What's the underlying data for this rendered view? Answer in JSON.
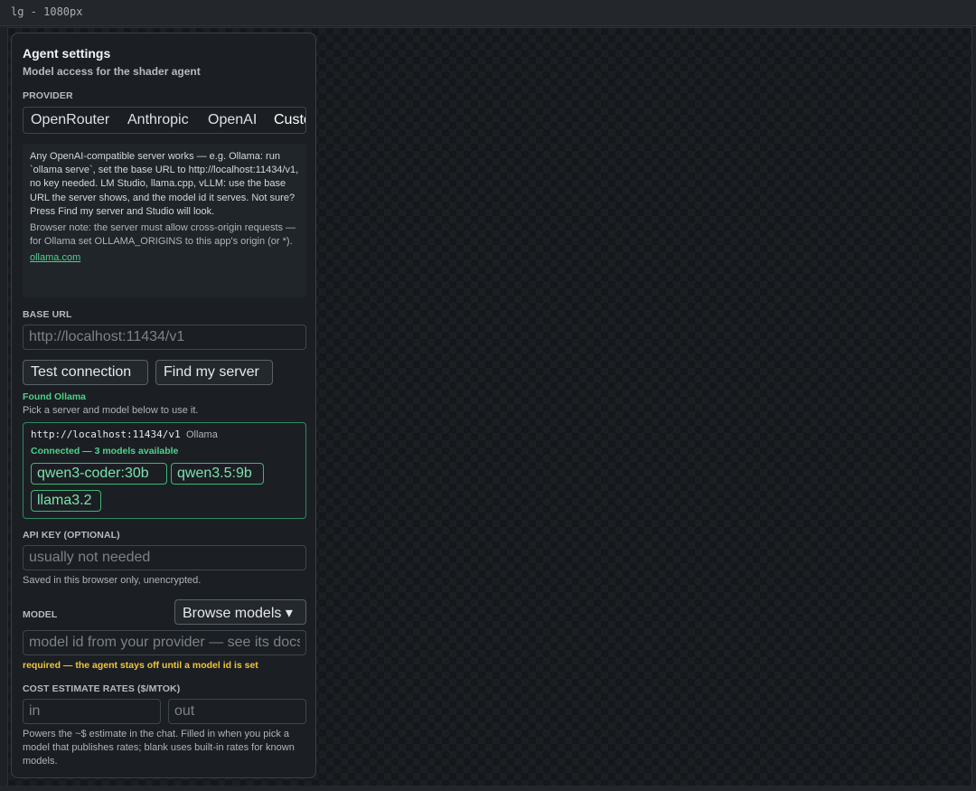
{
  "window": {
    "label": "lg - 1080px"
  },
  "panel": {
    "title": "Agent settings",
    "subtitle": "Model access for the shader agent",
    "provider": {
      "label": "PROVIDER",
      "tabs": [
        "OpenRouter",
        "Anthropic",
        "OpenAI",
        "Custom"
      ],
      "selected": "Custom"
    },
    "info": {
      "text": "Any OpenAI-compatible server works — e.g. Ollama: run `ollama serve`, set the base URL to http://localhost:11434/v1, no key needed. LM Studio, llama.cpp, vLLM: use the base URL the server shows, and the model id it serves. Not sure? Press Find my server and Studio will look.",
      "note": "Browser note: the server must allow cross-origin requests — for Ollama set OLLAMA_ORIGINS to this app's origin (or *).",
      "link": "ollama.com"
    },
    "base_url": {
      "label": "BASE URL",
      "placeholder": "http://localhost:11434/v1",
      "value": ""
    },
    "buttons": {
      "test": "Test connection",
      "find": "Find my server"
    },
    "found": {
      "status": "Found Ollama",
      "hint": "Pick a server and model below to use it."
    },
    "server": {
      "url": "http://localhost:11434/v1",
      "kind": "Ollama",
      "status": "Connected — 3 models available",
      "models": [
        "qwen3-coder:30b",
        "qwen3.5:9b",
        "llama3.2"
      ]
    },
    "api_key": {
      "label": "API KEY (OPTIONAL)",
      "placeholder": "usually not needed",
      "value": "",
      "hint": "Saved in this browser only, unencrypted."
    },
    "model": {
      "label": "MODEL",
      "browse": "Browse models ▾",
      "placeholder": "model id from your provider — see its docs",
      "value": "",
      "warning": "required — the agent stays off until a model id is set"
    },
    "rates": {
      "label": "COST ESTIMATE RATES ($/MTOK)",
      "in_placeholder": "in",
      "out_placeholder": "out",
      "hint": "Powers the ~$ estimate in the chat. Filled in when you pick a model that publishes rates; blank uses built-in rates for known models."
    }
  },
  "colors": {
    "accent_green": "#4fd08a",
    "warning_yellow": "#f0c43a",
    "panel_bg": "#1b1f23"
  }
}
